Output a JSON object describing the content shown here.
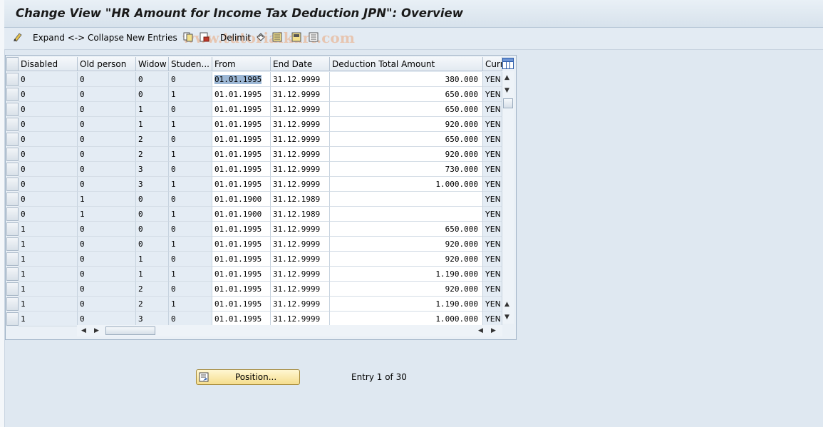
{
  "window": {
    "title": "Change View \"HR Amount for Income Tax Deduction JPN\": Overview"
  },
  "toolbar": {
    "expand_collapse": "Expand <-> Collapse",
    "new_entries": "New Entries",
    "delimit": "Delimit",
    "watermark": "www.tutorialkart.com"
  },
  "table": {
    "columns": [
      "Disabled",
      "Old person",
      "Widow",
      "Studen...",
      "From",
      "End Date",
      "Deduction Total Amount",
      "Curr"
    ],
    "rows": [
      [
        "0",
        "0",
        "0",
        "0",
        "01.01.1995",
        "31.12.9999",
        "380.000",
        "YEN"
      ],
      [
        "0",
        "0",
        "0",
        "1",
        "01.01.1995",
        "31.12.9999",
        "650.000",
        "YEN"
      ],
      [
        "0",
        "0",
        "1",
        "0",
        "01.01.1995",
        "31.12.9999",
        "650.000",
        "YEN"
      ],
      [
        "0",
        "0",
        "1",
        "1",
        "01.01.1995",
        "31.12.9999",
        "920.000",
        "YEN"
      ],
      [
        "0",
        "0",
        "2",
        "0",
        "01.01.1995",
        "31.12.9999",
        "650.000",
        "YEN"
      ],
      [
        "0",
        "0",
        "2",
        "1",
        "01.01.1995",
        "31.12.9999",
        "920.000",
        "YEN"
      ],
      [
        "0",
        "0",
        "3",
        "0",
        "01.01.1995",
        "31.12.9999",
        "730.000",
        "YEN"
      ],
      [
        "0",
        "0",
        "3",
        "1",
        "01.01.1995",
        "31.12.9999",
        "1.000.000",
        "YEN"
      ],
      [
        "0",
        "1",
        "0",
        "0",
        "01.01.1900",
        "31.12.1989",
        "",
        "YEN"
      ],
      [
        "0",
        "1",
        "0",
        "1",
        "01.01.1900",
        "31.12.1989",
        "",
        "YEN"
      ],
      [
        "1",
        "0",
        "0",
        "0",
        "01.01.1995",
        "31.12.9999",
        "650.000",
        "YEN"
      ],
      [
        "1",
        "0",
        "0",
        "1",
        "01.01.1995",
        "31.12.9999",
        "920.000",
        "YEN"
      ],
      [
        "1",
        "0",
        "1",
        "0",
        "01.01.1995",
        "31.12.9999",
        "920.000",
        "YEN"
      ],
      [
        "1",
        "0",
        "1",
        "1",
        "01.01.1995",
        "31.12.9999",
        "1.190.000",
        "YEN"
      ],
      [
        "1",
        "0",
        "2",
        "0",
        "01.01.1995",
        "31.12.9999",
        "920.000",
        "YEN"
      ],
      [
        "1",
        "0",
        "2",
        "1",
        "01.01.1995",
        "31.12.9999",
        "1.190.000",
        "YEN"
      ],
      [
        "1",
        "0",
        "3",
        "0",
        "01.01.1995",
        "31.12.9999",
        "1.000.000",
        "YEN"
      ]
    ]
  },
  "footer": {
    "position_label": "Position...",
    "entry_info": "Entry 1 of 30"
  },
  "colors": {
    "background": "#dfe8f1",
    "button": "#f5dd8d",
    "selection": "#9db8d6"
  }
}
